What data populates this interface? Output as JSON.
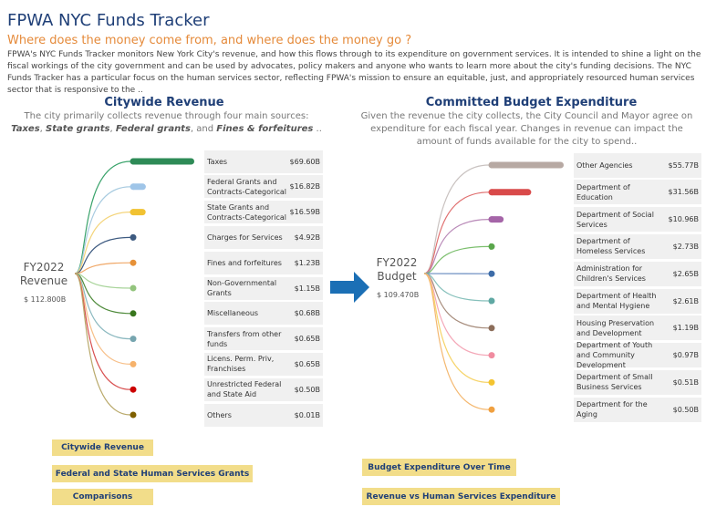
{
  "header": {
    "title": "FPWA NYC Funds Tracker",
    "subtitle": "Where does the money come from, and where does the money go ?",
    "intro": "FPWA's NYC Funds Tracker monitors New York City's revenue, and how this flows through to its expenditure on government services. It is intended to shine a light on the fiscal workings of the city government and can be used by advocates, policy makers and anyone who wants to learn more about the city's funding decisions. The NYC Funds Tracker has a particular focus on the human services sector, reflecting FPWA's mission to ensure an equitable, just, and appropriately resourced human services sector that is responsive to the .."
  },
  "revenue": {
    "title": "Citywide Revenue",
    "desc_prefix": "The city primarily collects revenue through four main sources: ",
    "desc_taxes": "Taxes",
    "desc_sep1": ", ",
    "desc_state": "State grants",
    "desc_sep2": ", ",
    "desc_federal": "Federal grants",
    "desc_sep3": ", and ",
    "desc_fines": "Fines & forfeitures",
    "desc_suffix": " ..",
    "fy_line1": "FY2022",
    "fy_line2": "Revenue",
    "total": "$  112.800B"
  },
  "expenditure": {
    "title": "Committed Budget Expenditure",
    "desc": "Given the revenue the city collects, the City Council and Mayor agree on expenditure for each fiscal year. Changes in revenue can impact the amount of funds available for the city to spend..",
    "fy_line1": "FY2022",
    "fy_line2": "Budget",
    "total": "$  109.470B"
  },
  "chart_data": [
    {
      "type": "bar",
      "categories": [
        "Taxes",
        "Federal Grants and Contracts-Categorical",
        "State Grants and Contracts-Categorical",
        "Charges for Services",
        "Fines and forfeitures",
        "Non-Governmental Grants",
        "Miscellaneous",
        "Transfers from other funds",
        "Licens. Perm. Priv, Franchises",
        "Unrestricted Federal and State Aid",
        "Others"
      ],
      "values": [
        69.6,
        16.82,
        16.59,
        4.92,
        1.23,
        1.15,
        0.68,
        0.65,
        0.65,
        0.5,
        0.01
      ],
      "labels": [
        "$69.60B",
        "$16.82B",
        "$16.59B",
        "$4.92B",
        "$1.23B",
        "$1.15B",
        "$0.68B",
        "$0.65B",
        "$0.65B",
        "$0.50B",
        "$0.01B"
      ],
      "colors": [
        "#2e8b57",
        "#9fc5e8",
        "#f1c232",
        "#3d5a80",
        "#e69138",
        "#93c47d",
        "#38761d",
        "#76a5af",
        "#f6b26b",
        "#cc0000",
        "#7f6000"
      ],
      "flow_colors": [
        "#3aa36b",
        "#a8cbe0",
        "#f4d47a",
        "#3d5a80",
        "#f0a868",
        "#a8d49a",
        "#4e8a3a",
        "#8cb9c0",
        "#f7c08a",
        "#d85050",
        "#b9a96a"
      ]
    },
    {
      "type": "bar",
      "categories": [
        "Other Agencies",
        "Department of Education",
        "Department of Social Services",
        "Department of Homeless Services",
        "Administration for Children's Services",
        "Department of Health and Mental Hygiene",
        "Housing Preservation and Development",
        "Department of Youth and Community Development",
        "Department of Small Business Services",
        "Department for the Aging"
      ],
      "values": [
        55.77,
        31.56,
        10.96,
        2.73,
        2.65,
        2.61,
        1.19,
        0.97,
        0.51,
        0.5
      ],
      "labels": [
        "$55.77B",
        "$31.56B",
        "$10.96B",
        "$2.73B",
        "$2.65B",
        "$2.61B",
        "$1.19B",
        "$0.97B",
        "$0.51B",
        "$0.50B"
      ],
      "colors": [
        "#b7a9a3",
        "#d94a4a",
        "#a565a8",
        "#5aa64b",
        "#3d6ca8",
        "#5fa8a3",
        "#8c6d5a",
        "#f08ca0",
        "#f4c430",
        "#f0a040"
      ],
      "flow_colors": [
        "#c9c2c0",
        "#e07070",
        "#b98ab8",
        "#7cbf6e",
        "#6a8cc0",
        "#86c0bb",
        "#a88e7e",
        "#f4a8b8",
        "#f6d46a",
        "#f4b870"
      ]
    }
  ],
  "buttons": {
    "citywide_revenue": "Citywide Revenue",
    "fed_state_grants": "Federal and State Human Services Grants",
    "comparisons": "Comparisons",
    "budget_over_time": "Budget Expenditure Over Time",
    "revenue_vs_hs": "Revenue vs Human Services Expenditure"
  },
  "colors": {
    "title": "#1f3f77",
    "subtitle": "#e58a3a",
    "arrow": "#1b6fb5",
    "button": "#f2dd8a"
  }
}
